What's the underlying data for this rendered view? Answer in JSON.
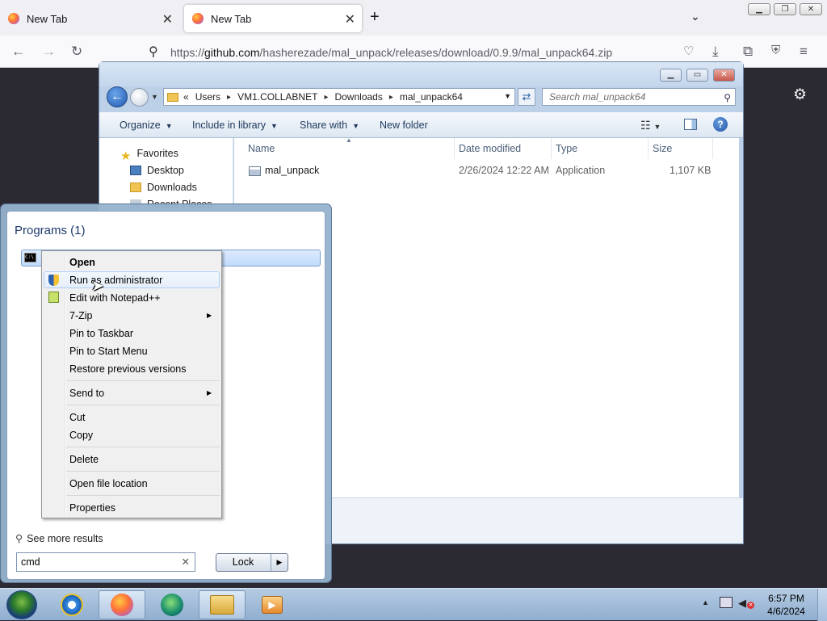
{
  "browser": {
    "tabs": [
      {
        "label": "New Tab",
        "active": false
      },
      {
        "label": "New Tab",
        "active": true
      }
    ],
    "url": "https://github.com/hasherezade/mal_unpack/releases/download/0.9.9/mal_unpack64.zip",
    "url_host": "github.com",
    "url_prefix": "https://",
    "url_path": "/hasherezade/mal_unpack/releases/download/0.9.9/mal_unpack64.zip"
  },
  "explorer": {
    "breadcrumb": [
      "Users",
      "VM1.COLLABNET",
      "Downloads",
      "mal_unpack64"
    ],
    "breadcrumb_prefix": "«",
    "search_placeholder": "Search mal_unpack64",
    "toolbar": {
      "organize": "Organize",
      "include": "Include in library",
      "share": "Share with",
      "newfolder": "New folder"
    },
    "nav": {
      "favorites": "Favorites",
      "desktop": "Desktop",
      "downloads": "Downloads",
      "recent": "Recent Places"
    },
    "columns": {
      "name": "Name",
      "date": "Date modified",
      "type": "Type",
      "size": "Size"
    },
    "files": [
      {
        "name": "mal_unpack",
        "date": "2/26/2024 12:22 AM",
        "type": "Application",
        "size": "1,107 KB"
      }
    ]
  },
  "startmenu": {
    "programs_title": "Programs (1)",
    "program_item": "cmd",
    "see_more": "See more results",
    "search_value": "cmd",
    "lock_label": "Lock"
  },
  "context_menu": {
    "open": "Open",
    "run_admin": "Run as administrator",
    "edit_npp": "Edit with Notepad++",
    "zip": "7-Zip",
    "pin_taskbar": "Pin to Taskbar",
    "pin_start": "Pin to Start Menu",
    "restore": "Restore previous versions",
    "send_to": "Send to",
    "cut": "Cut",
    "copy": "Copy",
    "delete": "Delete",
    "open_location": "Open file location",
    "properties": "Properties"
  },
  "taskbar": {
    "time": "6:57 PM",
    "date": "4/6/2024"
  }
}
